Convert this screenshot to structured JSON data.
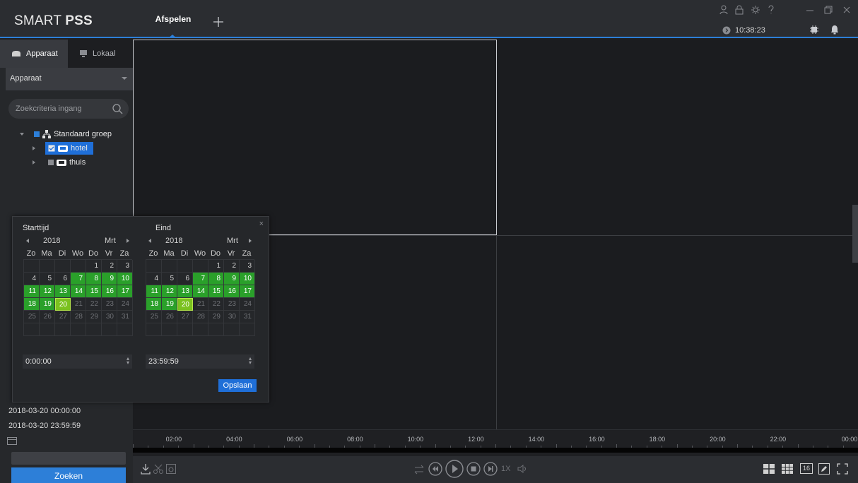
{
  "app": {
    "logo_prefix": "SMART ",
    "logo_bold": "PSS",
    "active_tab": "Afspelen",
    "clock": "10:38:23",
    "accent_color": "#2d7fd8",
    "icons": [
      "user-icon",
      "lock-icon",
      "gear-icon",
      "help-icon",
      "minimize-icon",
      "restore-icon",
      "close-icon",
      "clock-icon",
      "cpu-icon",
      "bell-icon",
      "plus-icon"
    ]
  },
  "sidebar": {
    "tabs": [
      {
        "label": "Apparaat"
      },
      {
        "label": "Lokaal"
      }
    ],
    "dropdown_value": "Apparaat",
    "search_placeholder": "Zoekcriteria ingang",
    "tree": {
      "group": "Standaard groep",
      "devices": [
        {
          "label": "hotel",
          "selected": true
        },
        {
          "label": "thuis",
          "selected": false
        }
      ]
    },
    "start_datetime": "2018-03-20 00:00:00",
    "end_datetime": "2018-03-20 23:59:59",
    "search_button": "Zoeken"
  },
  "popup": {
    "close": "×",
    "start": {
      "label": "Starttijd",
      "year": "2018",
      "month": "Mrt",
      "time": "0:00:00"
    },
    "end": {
      "label": "Eind",
      "year": "2018",
      "month": "Mrt",
      "time": "23:59:59"
    },
    "weekdays": [
      "Zo",
      "Ma",
      "Di",
      "Wo",
      "Do",
      "Vr",
      "Za"
    ],
    "save_button": "Opslaan",
    "days": [
      [
        "",
        "",
        "",
        "",
        "1",
        "2",
        "3"
      ],
      [
        "4",
        "5",
        "6",
        "7",
        "8",
        "9",
        "10"
      ],
      [
        "11",
        "12",
        "13",
        "14",
        "15",
        "16",
        "17"
      ],
      [
        "18",
        "19",
        "20",
        "21",
        "22",
        "23",
        "24"
      ],
      [
        "25",
        "26",
        "27",
        "28",
        "29",
        "30",
        "31"
      ],
      [
        "",
        "",
        "",
        "",
        "",
        "",
        ""
      ]
    ],
    "recorded_days": [
      "7",
      "8",
      "9",
      "10",
      "11",
      "12",
      "13",
      "14",
      "15",
      "16",
      "17",
      "18",
      "19"
    ],
    "selected_day": "20",
    "future_days": [
      "21",
      "22",
      "23",
      "24",
      "25",
      "26",
      "27",
      "28",
      "29",
      "30",
      "31"
    ]
  },
  "timeline": {
    "labels": [
      "02:00",
      "04:00",
      "06:00",
      "08:00",
      "10:00",
      "12:00",
      "14:00",
      "16:00",
      "18:00",
      "20:00",
      "22:00",
      "00:00"
    ]
  },
  "playback": {
    "speed": "1X",
    "grid_16_label": "16",
    "icons": [
      "download-icon",
      "scissors-icon",
      "snapshot-icon",
      "sync-icon",
      "rewind-icon",
      "play-icon",
      "stop-icon",
      "step-icon",
      "volume-icon",
      "layout-4-icon",
      "layout-9-icon",
      "layout-16-icon",
      "edit-icon",
      "fullscreen-icon"
    ]
  }
}
